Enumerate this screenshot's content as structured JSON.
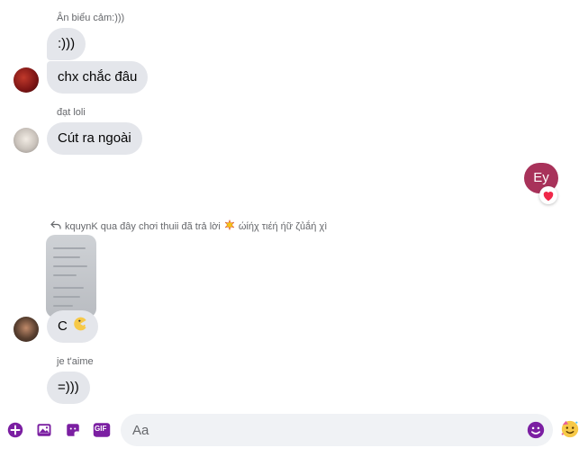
{
  "messages": {
    "m1": {
      "sender": "Ân biểu cảm:)))",
      "texts": [
        ":)))",
        "chx chắc đâu"
      ]
    },
    "m2": {
      "sender": "đạt loli",
      "text": "Cút ra ngoài"
    },
    "m3": {
      "text": "Ey",
      "reaction": "red-heart"
    },
    "m4": {
      "reply_info": "kquynK qua đây chơi thuii đã trả lời",
      "reply_target": "ώίήχ τιέή ήữ ζủắή χì",
      "text": "C",
      "emoji": "pac-man-face"
    },
    "m5": {
      "sender": "je t'aime",
      "text": "=)))"
    }
  },
  "composer": {
    "placeholder": "Aa",
    "tools": [
      "plus-icon",
      "image-icon",
      "sticker-icon",
      "gif-icon"
    ],
    "gif_label": "GIF",
    "accent": "#7b1fa2"
  },
  "colors": {
    "incoming_bubble": "#e4e6eb",
    "outgoing_bubble": "#a8325a",
    "secondary_text": "#65676b"
  }
}
